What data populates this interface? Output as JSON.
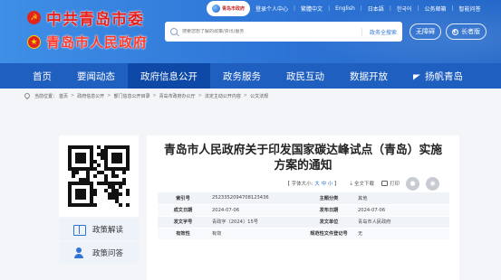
{
  "header": {
    "brand_line1": "中共青岛市委",
    "brand_line2": "青岛市人民政府",
    "logo_badge": "青岛市政府",
    "top_links": [
      "登录个人中心",
      "繁體中文",
      "English",
      "日本語",
      "한국어",
      "公务邮箱",
      "智能问答"
    ],
    "search_placeholder": "搜索您想了解的政策/资讯/服务",
    "search_button": "政务全搜索",
    "access_barrier_free": "无障碍",
    "access_elderly": "长者版"
  },
  "nav": {
    "items": [
      "首页",
      "要闻动态",
      "政府信息公开",
      "政务服务",
      "政民互动",
      "数据开放",
      "扬帆青岛"
    ],
    "active_index": 2
  },
  "breadcrumb": {
    "label": "当前位置：",
    "items": [
      "首页",
      "政府信息公开",
      "部门信息公开目录",
      "青岛市政府办公厅",
      "法定主动公开内容",
      "公文法规"
    ]
  },
  "sidebar": {
    "items": [
      {
        "label": "政策解读",
        "icon": "book-icon"
      },
      {
        "label": "政策问答",
        "icon": "person-icon"
      }
    ]
  },
  "article": {
    "title": "青岛市人民政府关于印发国家碳达峰试点（青岛）实施方案的通知",
    "toolbar": {
      "font_size_label": "【 字体大小:",
      "size_large": "大",
      "size_medium": "中",
      "size_small": "小",
      "font_size_close": "】",
      "fullscreen": "全文下载",
      "print": "打印"
    },
    "meta": [
      {
        "k1": "索引号",
        "v1": "2523352094708123436",
        "k2": "主题分类",
        "v2": "其他"
      },
      {
        "k1": "成文日期",
        "v1": "2024-07-06",
        "k2": "发布日期",
        "v2": "2024-07-06"
      },
      {
        "k1": "发文字号",
        "v1": "青政字〔2024〕15号",
        "k2": "发文单位",
        "v2": "青岛市人民政府"
      },
      {
        "k1": "有效性",
        "v1": "有效",
        "k2": "规范性文件登记号",
        "v2": "无"
      }
    ]
  },
  "colors": {
    "header_blue": "#2d74d6",
    "nav_blue": "#1f5fc0",
    "nav_active": "#0e49a8",
    "brand_red": "#e8211c"
  }
}
